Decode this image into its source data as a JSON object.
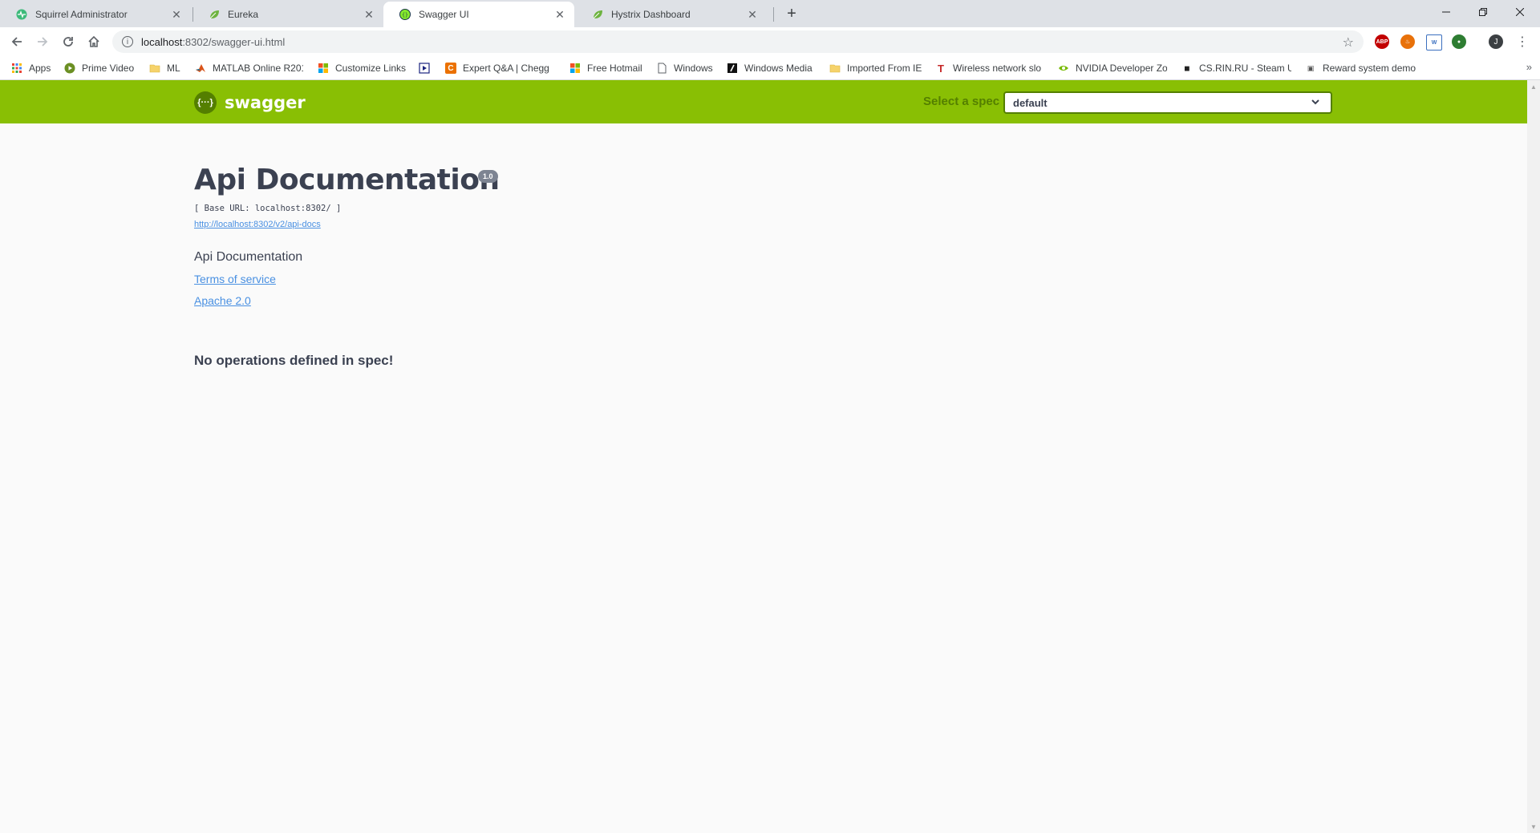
{
  "browser": {
    "tabs": [
      {
        "title": "Squirrel Administrator",
        "icon": "squirrel-icon",
        "active": false
      },
      {
        "title": "Eureka",
        "icon": "spring-leaf-icon",
        "active": false
      },
      {
        "title": "Swagger UI",
        "icon": "swagger-icon",
        "active": true
      },
      {
        "title": "Hystrix Dashboard",
        "icon": "spring-leaf-icon",
        "active": false
      }
    ],
    "address": {
      "host": "localhost",
      "path": ":8302/swagger-ui.html"
    },
    "bookmarks": [
      {
        "label": "Apps",
        "icon": "apps-grid-icon"
      },
      {
        "label": "Prime Video",
        "icon": "play-icon"
      },
      {
        "label": "ML",
        "icon": "folder-icon"
      },
      {
        "label": "MATLAB Online R201",
        "icon": "matlab-icon"
      },
      {
        "label": "Customize Links",
        "icon": "windows-icon"
      },
      {
        "label": "",
        "icon": "media-icon"
      },
      {
        "label": "Expert Q&A | Chegg",
        "icon": "chegg-icon"
      },
      {
        "label": "Free Hotmail",
        "icon": "windows-icon"
      },
      {
        "label": "Windows",
        "icon": "page-icon"
      },
      {
        "label": "Windows Media",
        "icon": "windows-media-icon"
      },
      {
        "label": "Imported From IE",
        "icon": "folder-icon"
      },
      {
        "label": "Wireless network slo",
        "icon": "t-icon"
      },
      {
        "label": "NVIDIA Developer Zo",
        "icon": "nvidia-icon"
      },
      {
        "label": "CS.RIN.RU - Steam U",
        "icon": "csrin-icon"
      },
      {
        "label": "Reward system demo",
        "icon": "reward-icon"
      }
    ],
    "overflow_label": "»",
    "profile_initial": "J",
    "extensions": [
      "ABP",
      "fire-icon",
      "doc-icon",
      "globe-icon"
    ]
  },
  "swagger": {
    "brand": "swagger",
    "logo_glyph": "{···}",
    "spec_label": "Select a spec",
    "spec_selected": "default",
    "title": "Api Documentation",
    "version": "1.0",
    "base_url": "[ Base URL: localhost:8302/ ]",
    "docs_url": "http://localhost:8302/v2/api-docs",
    "description": "Api Documentation",
    "terms": "Terms of service",
    "license": "Apache 2.0",
    "empty_message": "No operations defined in spec!",
    "colors": {
      "topbar": "#89bf04",
      "topbar_dark": "#547f00",
      "link": "#4990e2",
      "text": "#3b4151"
    }
  }
}
